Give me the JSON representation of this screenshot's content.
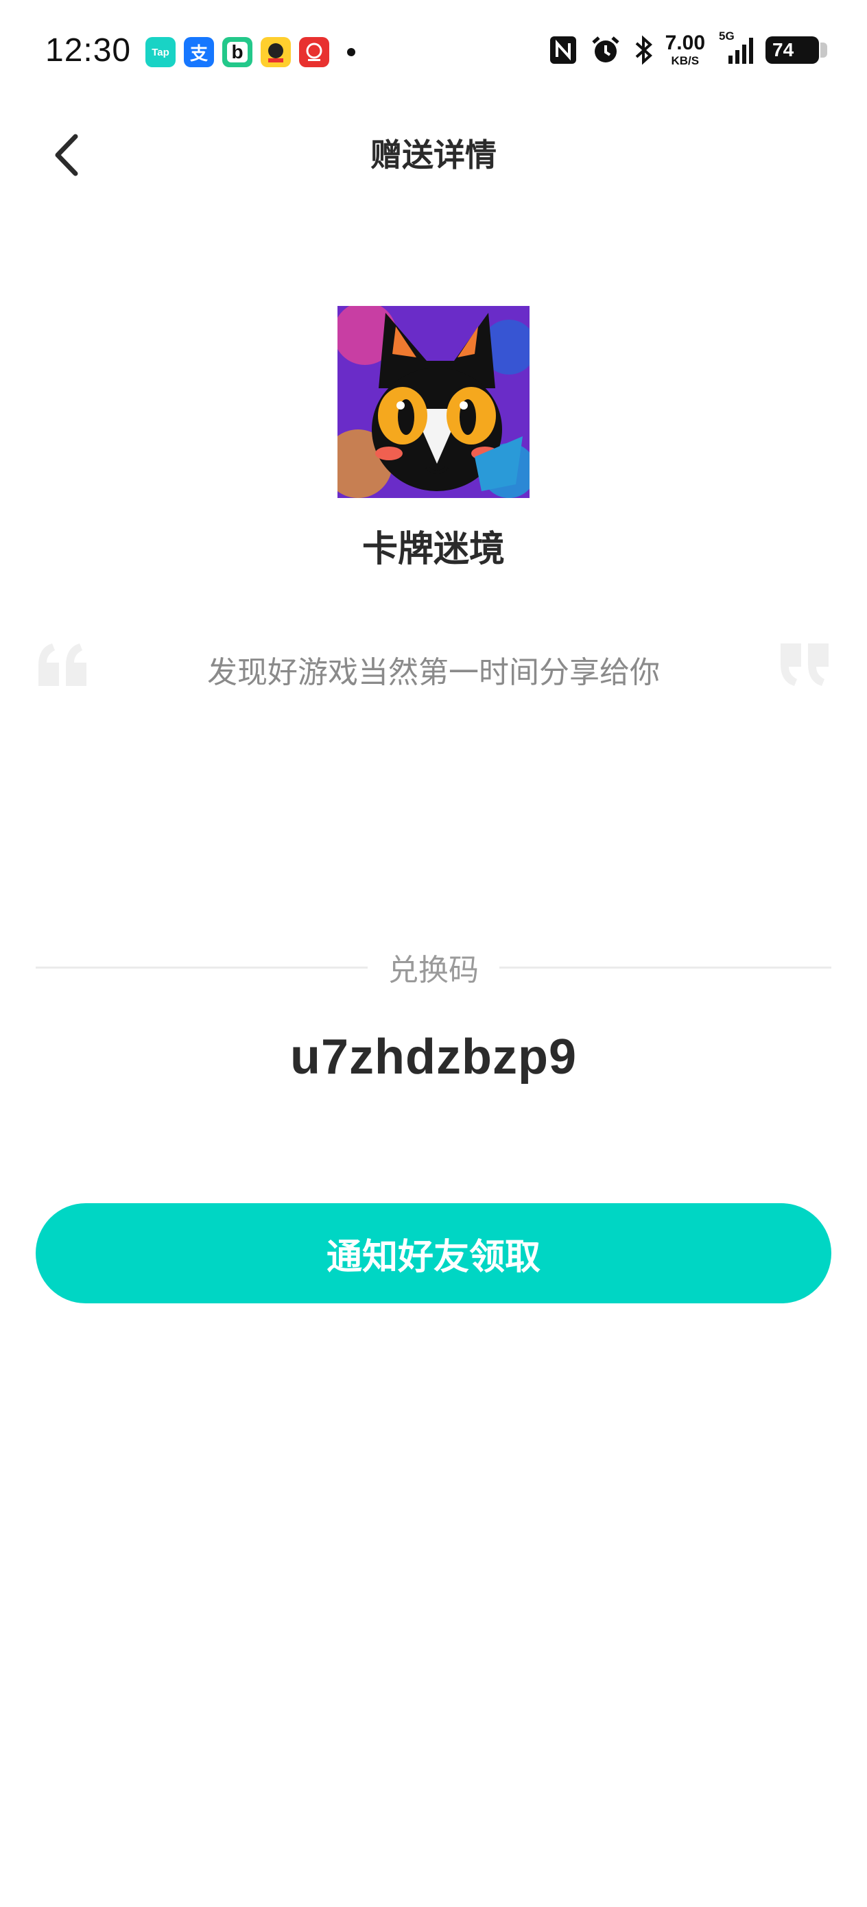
{
  "status_bar": {
    "time": "12:30",
    "net_speed_value": "7.00",
    "net_speed_unit": "KB/S",
    "network": "5G",
    "battery": "74",
    "app_icons": [
      {
        "name": "taptap-icon",
        "label": "Tap",
        "color": "#19d3c5"
      },
      {
        "name": "alipay-icon",
        "label": "支",
        "color": "#1677ff"
      },
      {
        "name": "bilibili-icon",
        "label": "b",
        "color": "#23c88a"
      },
      {
        "name": "app-icon-yellow",
        "label": "",
        "color": "#ffcf2e"
      },
      {
        "name": "app-icon-red",
        "label": "",
        "color": "#e8312f"
      }
    ]
  },
  "nav": {
    "title": "赠送详情",
    "back_icon": "chevron-left-icon"
  },
  "game": {
    "name": "卡牌迷境"
  },
  "quote": {
    "text": "发现好游戏当然第一时间分享给你"
  },
  "redeem": {
    "label": "兑换码",
    "code": "u7zhdzbzp9"
  },
  "action": {
    "notify_label": "通知好友领取"
  },
  "colors": {
    "accent": "#00d6c4",
    "title_text": "#2b2b2b",
    "muted_text": "#8a8a8a"
  }
}
